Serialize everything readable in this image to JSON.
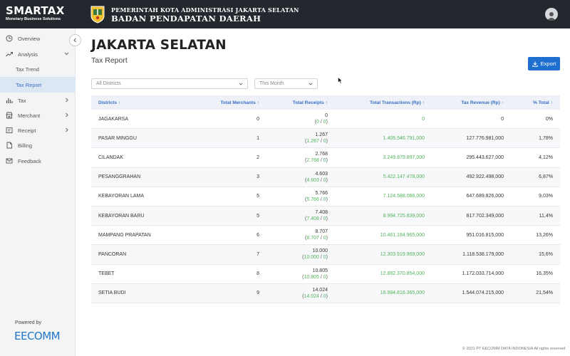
{
  "brand": {
    "name": "SMARTAX",
    "tagline": "Monetary Business Solutions"
  },
  "government": {
    "line1": "PEMERINTAH KOTA ADMINISTRASI JAKARTA SELATAN",
    "line2": "BADAN PENDAPATAN DAERAH"
  },
  "sidebar": {
    "items": [
      {
        "label": "Overview",
        "icon": "clock-icon"
      },
      {
        "label": "Analysis",
        "icon": "trend-icon",
        "expanded": true
      },
      {
        "label": "Tax Trend",
        "sub": true
      },
      {
        "label": "Tax Report",
        "sub": true,
        "active": true
      },
      {
        "label": "Tax",
        "icon": "bar-chart-icon"
      },
      {
        "label": "Merchant",
        "icon": "store-icon"
      },
      {
        "label": "Receipt",
        "icon": "receipt-icon"
      },
      {
        "label": "Billing",
        "icon": "file-icon"
      },
      {
        "label": "Feedback",
        "icon": "mail-icon"
      }
    ],
    "powered_by": "Powered by",
    "partner_logo": "EECOMM"
  },
  "page": {
    "title": "JAKARTA SELATAN",
    "subtitle": "Tax Report"
  },
  "toolbar": {
    "export_label": "Export"
  },
  "filters": {
    "district": "All Districts",
    "period": "This Month"
  },
  "table": {
    "headers": [
      "Districts",
      "Total Merchants",
      "Total Receipts",
      "Total Transactions (Rp)",
      "Tax Revenue (Rp)",
      "% Total"
    ],
    "rows": [
      {
        "district": "JAGAKARSA",
        "merchants": "0",
        "receipts": "0",
        "receipts_sub": "0",
        "receipts_den": "0",
        "transactions": "0",
        "revenue": "0",
        "pct": "0%"
      },
      {
        "district": "PASAR MINGGU",
        "merchants": "1",
        "receipts": "1.267",
        "receipts_sub": "1.267",
        "receipts_den": "0",
        "transactions": "1.405.546.791,000",
        "revenue": "127.776.981,000",
        "pct": "1,78%"
      },
      {
        "district": "CILANDAK",
        "merchants": "2",
        "receipts": "2.768",
        "receipts_sub": "2.768",
        "receipts_den": "0",
        "transactions": "3.249.879.897,000",
        "revenue": "295.443.627,000",
        "pct": "4,12%"
      },
      {
        "district": "PESANGGRAHAN",
        "merchants": "3",
        "receipts": "4.603",
        "receipts_sub": "4.603",
        "receipts_den": "0",
        "transactions": "5.422.147.478,000",
        "revenue": "492.922.498,000",
        "pct": "6,87%"
      },
      {
        "district": "KEBAYORAN LAMA",
        "merchants": "5",
        "receipts": "5.766",
        "receipts_sub": "5.766",
        "receipts_den": "0",
        "transactions": "7.124.588.086,000",
        "revenue": "647.689.826,000",
        "pct": "9,03%"
      },
      {
        "district": "KEBAYORAN BARU",
        "merchants": "5",
        "receipts": "7.408",
        "receipts_sub": "7.408",
        "receipts_den": "0",
        "transactions": "8.994.725.839,000",
        "revenue": "817.702.349,000",
        "pct": "11,4%"
      },
      {
        "district": "MAMPANG PRAPATAN",
        "merchants": "6",
        "receipts": "8.707",
        "receipts_sub": "8.707",
        "receipts_den": "0",
        "transactions": "10.461.184.965,000",
        "revenue": "951.016.815,000",
        "pct": "13,26%"
      },
      {
        "district": "PANCORAN",
        "merchants": "7",
        "receipts": "10.000",
        "receipts_sub": "10.000",
        "receipts_den": "0",
        "transactions": "12.303.919.969,000",
        "revenue": "1.118.538.179,000",
        "pct": "15,6%"
      },
      {
        "district": "TEBET",
        "merchants": "8",
        "receipts": "10.805",
        "receipts_sub": "10.805",
        "receipts_den": "0",
        "transactions": "12.892.370.854,000",
        "revenue": "1.172.033.714,000",
        "pct": "16,35%"
      },
      {
        "district": "SETIA BUDI",
        "merchants": "9",
        "receipts": "14.024",
        "receipts_sub": "14.024",
        "receipts_den": "0",
        "transactions": "16.984.816.365,000",
        "revenue": "1.544.074.215,000",
        "pct": "21,54%"
      }
    ]
  },
  "footer": {
    "copyright": "© 2021 PT EECOMM DATA INDONESIA All rights reserved"
  },
  "colors": {
    "accent": "#1f6fd0",
    "header_bg": "#23272e",
    "positive": "#53b25b",
    "active_nav_bg": "#dce7f4"
  }
}
